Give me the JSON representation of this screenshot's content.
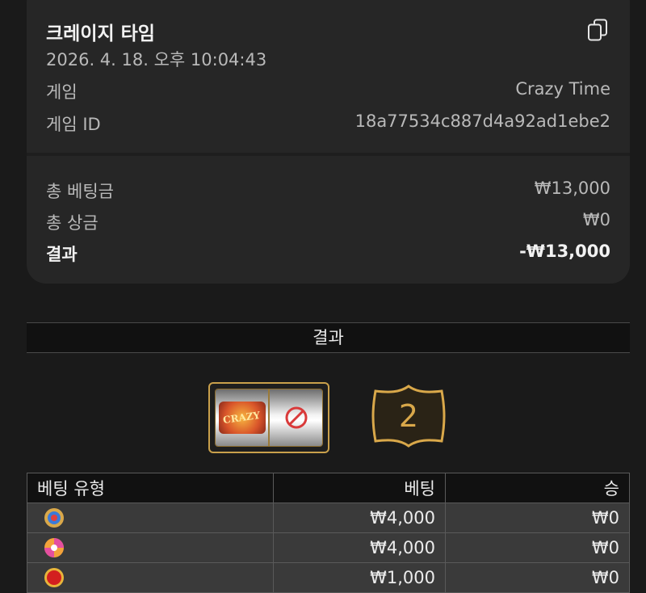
{
  "summary": {
    "title": "크레이지 타임",
    "datetime": "2026. 4. 18. 오후 10:04:43",
    "game_label": "게임",
    "game_value": "Crazy Time",
    "game_id_label": "게임 ID",
    "game_id_value": "18a77534c887d4a92ad1ebe2",
    "copy_icon": "copy-icon"
  },
  "totals": {
    "total_bet_label": "총 베팅금",
    "total_bet_value": "₩13,000",
    "total_win_label": "총 상금",
    "total_win_value": "₩0",
    "result_label": "결과",
    "result_value": "-₩13,000"
  },
  "results": {
    "header": "결과",
    "slot_logo_text": "CRAZY",
    "slot_symbol": "no-entry-icon",
    "wheel_result": "2"
  },
  "bets_table": {
    "headers": [
      "베팅 유형",
      "베팅",
      "승"
    ],
    "rows": [
      {
        "icon": "coin-flip-icon",
        "bet": "₩4,000",
        "win": "₩0"
      },
      {
        "icon": "pachinko-icon",
        "bet": "₩4,000",
        "win": "₩0"
      },
      {
        "icon": "cash-hunt-icon",
        "bet": "₩1,000",
        "win": "₩0"
      }
    ]
  },
  "colors": {
    "background": "#1a1a1a",
    "card": "#262626",
    "gold": "#c9a04b",
    "table_row": "#3a3a3a"
  }
}
